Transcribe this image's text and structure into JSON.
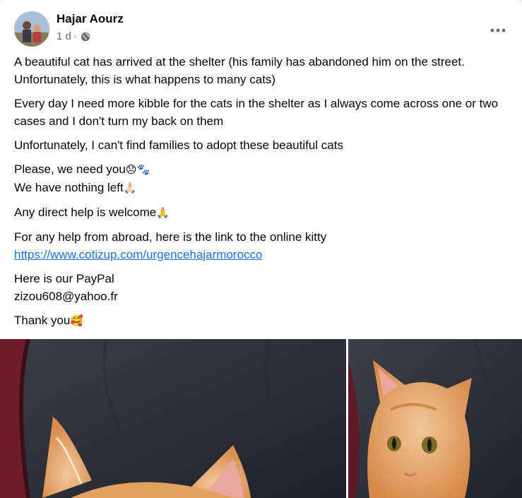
{
  "post": {
    "author": "Hajar Aourz",
    "time": "1 d",
    "separator": "·",
    "privacy_icon": "globe-icon",
    "more_icon": "more-horizontal-icon",
    "paragraphs": [
      {
        "lines": [
          {
            "text": "A beautiful cat has arrived at the shelter (his family has abandoned him on the street. Unfortunately, this is what happens to many cats)"
          }
        ]
      },
      {
        "lines": [
          {
            "text": " Every day I need more kibble for the cats in the shelter as I always come across one or two cases and I don't turn my back on them"
          }
        ]
      },
      {
        "lines": [
          {
            "text": "Unfortunately, I can't find families to adopt these beautiful cats"
          }
        ]
      },
      {
        "lines": [
          {
            "text": "Please, we need you",
            "emoji": "😞🐾"
          },
          {
            "text": "We have nothing left",
            "emoji": "🙏🏻"
          }
        ]
      },
      {
        "lines": [
          {
            "text": "Any direct help is welcome",
            "emoji": "🙏"
          }
        ]
      },
      {
        "lines": [
          {
            "text": "For any help from abroad, here is the link to the online kitty"
          },
          {
            "text": "https://www.cotizup.com/urgencehajarmorocco",
            "link": true
          }
        ]
      },
      {
        "lines": [
          {
            "text": "Here is our PayPal"
          },
          {
            "text": "zizou608@yahoo.fr"
          }
        ]
      },
      {
        "lines": [
          {
            "text": "Thank you",
            "emoji": "🥰"
          }
        ]
      }
    ],
    "photos": [
      {
        "name": "photo-cat-closeup",
        "subject": "orange kitten ears on dark car seat"
      },
      {
        "name": "photo-cat-portrait",
        "subject": "orange kitten face on dark car seat"
      }
    ]
  },
  "colors": {
    "link": "#216fdb",
    "meta_text": "#65676b",
    "background": "#ffffff"
  }
}
